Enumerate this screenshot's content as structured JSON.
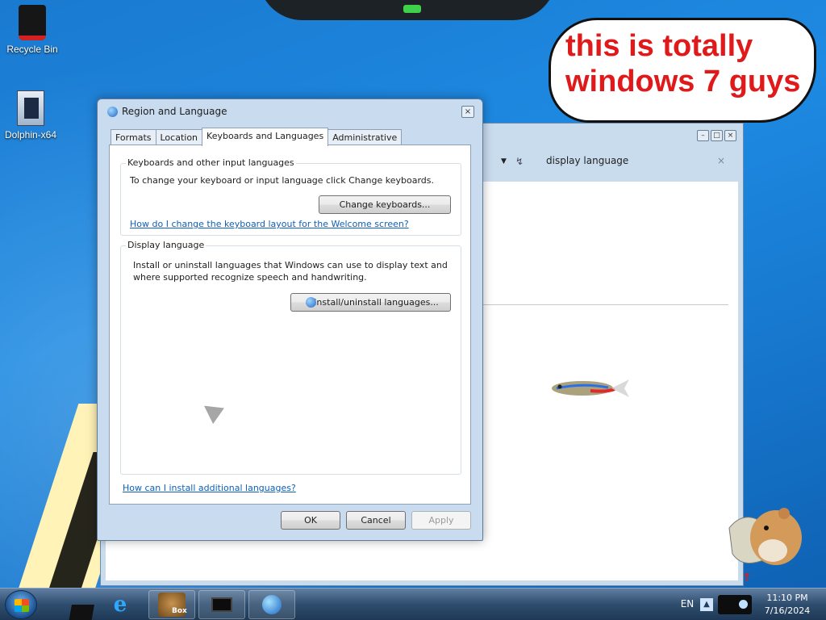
{
  "desktop": {
    "icons": [
      {
        "label": "Recycle Bin"
      },
      {
        "label": "Dolphin-x64"
      }
    ],
    "meme_text_line1": "this is totally",
    "meme_text_line2": "windows 7 guys"
  },
  "background_window": {
    "search_query": "display language",
    "clear_glyph": "×",
    "controls": [
      "–",
      "□",
      "×"
    ]
  },
  "dialog": {
    "title": "Region and Language",
    "close_glyph": "×",
    "tabs": [
      "Formats",
      "Location",
      "Keyboards and Languages",
      "Administrative"
    ],
    "active_tab": "Keyboards and Languages",
    "keyboards_group": {
      "legend": "Keyboards and other input languages",
      "description": "To change your keyboard or input language click Change keyboards.",
      "button": "Change keyboards...",
      "link": "How do I change the keyboard layout for the Welcome screen?"
    },
    "display_group": {
      "legend": "Display language",
      "description_line1": "Install or uninstall languages that Windows can use to display text and",
      "description_line2": "where supported recognize speech and handwriting.",
      "button": "Install/uninstall languages..."
    },
    "bottom_link": "How can I install additional languages?",
    "buttons": {
      "ok": "OK",
      "cancel": "Cancel",
      "apply": "Apply"
    }
  },
  "taskbar": {
    "pinned": [
      "explorer-cube",
      "internet-explorer",
      "box-app",
      "monitor-app",
      "globe-app"
    ],
    "box_label": "Box",
    "language": "EN",
    "tray_arrow": "▲",
    "time": "11:10 PM",
    "date": "7/16/2024"
  },
  "colors": {
    "desktop_blue": "#1e8ae2",
    "meme_red": "#e01a1a",
    "link_blue": "#0f5fb8",
    "dialog_frame": "#c9dbef"
  }
}
